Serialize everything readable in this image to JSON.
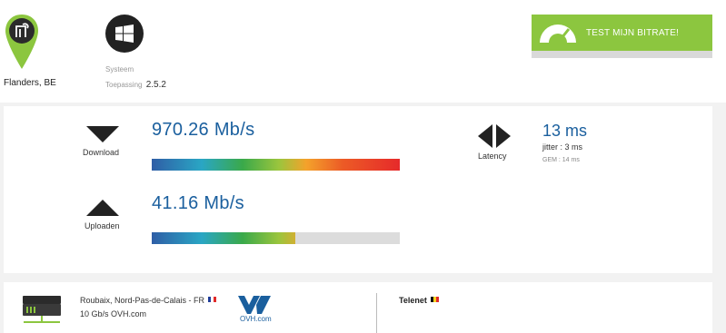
{
  "location": {
    "icon": "map-pin-icon",
    "label": "Flanders, BE"
  },
  "system": {
    "icon": "windows-logo-icon",
    "label": "Systeem",
    "app_label": "Toepassing",
    "app_version": "2.5.2"
  },
  "test_button": {
    "icon": "speedometer-icon",
    "label": "TEST MIJN BITRATE!"
  },
  "download": {
    "icon": "download-arrow-icon",
    "label": "Download",
    "value": "970.26 Mb/s",
    "bar_fraction": 1.0
  },
  "upload": {
    "icon": "upload-arrow-icon",
    "label": "Uploaden",
    "value": "41.16 Mb/s",
    "bar_fraction": 0.58
  },
  "latency": {
    "icon": "latency-icon",
    "label": "Latency",
    "value": "13 ms",
    "jitter": "jitter : 3 ms",
    "average": "GEM : 14 ms"
  },
  "server": {
    "icon": "server-icon",
    "location": "Roubaix, Nord-Pas-de-Calais - FR",
    "host": "10 Gb/s OVH.com",
    "provider_logo": "OVH.com"
  },
  "isp": {
    "name": "Telenet"
  },
  "colors": {
    "accent_green": "#8cc63f",
    "value_blue": "#1a5f9e"
  }
}
